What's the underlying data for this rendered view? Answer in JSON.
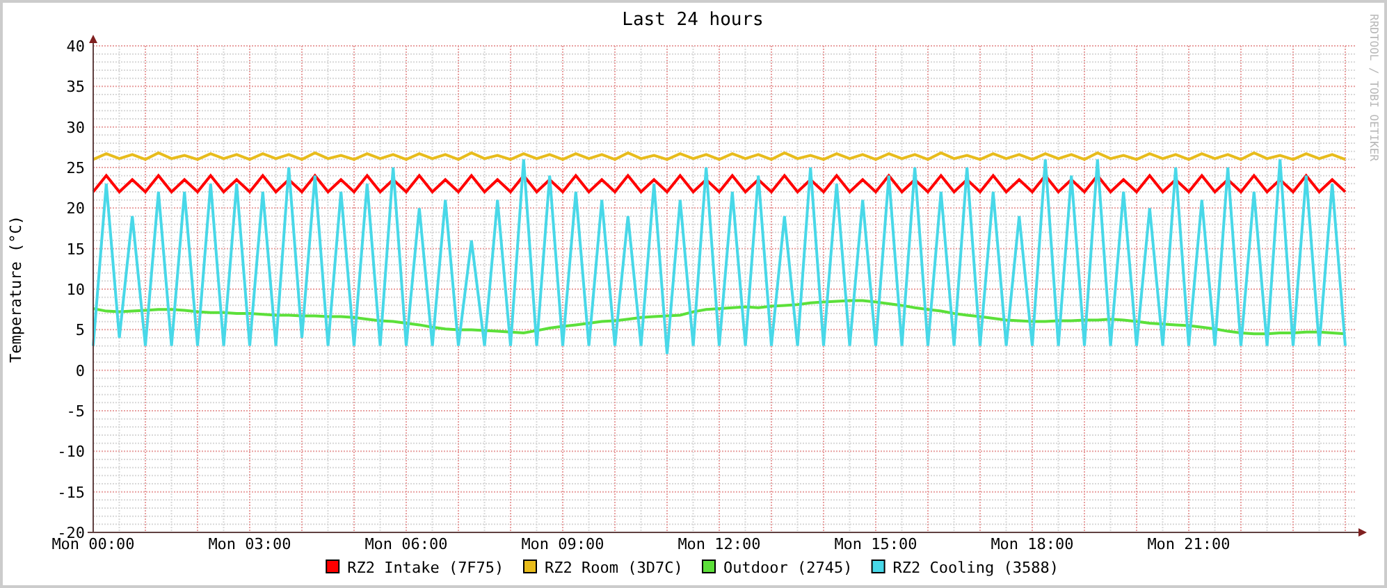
{
  "graph": {
    "credit": "RRDTOOL / TOBI OETIKER",
    "chart_data": {
      "type": "line",
      "title": "Last 24 hours",
      "ylabel": "Temperature (°C)",
      "categories": [
        "Mon 00:00",
        null,
        null,
        null,
        null,
        null,
        null,
        null,
        null,
        null,
        null,
        null,
        "Mon 03:00",
        null,
        null,
        null,
        null,
        null,
        null,
        null,
        null,
        null,
        null,
        null,
        "Mon 06:00",
        null,
        null,
        null,
        null,
        null,
        null,
        null,
        null,
        null,
        null,
        null,
        "Mon 09:00",
        null,
        null,
        null,
        null,
        null,
        null,
        null,
        null,
        null,
        null,
        null,
        "Mon 12:00",
        null,
        null,
        null,
        null,
        null,
        null,
        null,
        null,
        null,
        null,
        null,
        "Mon 15:00",
        null,
        null,
        null,
        null,
        null,
        null,
        null,
        null,
        null,
        null,
        null,
        "Mon 18:00",
        null,
        null,
        null,
        null,
        null,
        null,
        null,
        null,
        null,
        null,
        null,
        "Mon 21:00",
        null,
        null,
        null,
        null,
        null,
        null,
        null,
        null,
        null,
        null,
        null,
        null
      ],
      "ylim": [
        -20,
        40
      ],
      "grid": true,
      "legend": "bottom",
      "yticks": [
        -20,
        -15,
        -10,
        -5,
        0,
        5,
        10,
        15,
        20,
        25,
        30,
        35,
        40
      ],
      "series": [
        {
          "name": "RZ2 Intake (7F75)",
          "color": "#ff0000",
          "values": [
            22,
            24,
            22,
            23.5,
            22,
            24,
            22,
            23.5,
            22,
            24,
            22,
            23.5,
            22,
            24,
            22,
            23.5,
            22,
            24,
            22,
            23.5,
            22,
            24,
            22,
            23.5,
            22,
            24,
            22,
            23.5,
            22,
            24,
            22,
            23.5,
            22,
            24,
            22,
            23.5,
            22,
            24,
            22,
            23.5,
            22,
            24,
            22,
            23.5,
            22,
            24,
            22,
            23.5,
            22,
            24,
            22,
            23.5,
            22,
            24,
            22,
            23.5,
            22,
            24,
            22,
            23.5,
            22,
            24,
            22,
            23.5,
            22,
            24,
            22,
            23.5,
            22,
            24,
            22,
            23.5,
            22,
            24,
            22,
            23.5,
            22,
            24,
            22,
            23.5,
            22,
            24,
            22,
            23.5,
            22,
            24,
            22,
            23.5,
            22,
            24,
            22,
            23.5,
            22,
            24,
            22,
            23.5,
            22
          ]
        },
        {
          "name": "RZ2 Room (3D7C)",
          "color": "#e8bc1c",
          "values": [
            26,
            26.7,
            26.1,
            26.6,
            26,
            26.8,
            26.1,
            26.5,
            26,
            26.7,
            26.1,
            26.6,
            26,
            26.7,
            26.1,
            26.6,
            26,
            26.8,
            26.1,
            26.5,
            26,
            26.7,
            26.1,
            26.6,
            26,
            26.7,
            26.1,
            26.6,
            26,
            26.8,
            26.1,
            26.5,
            26,
            26.7,
            26.1,
            26.6,
            26,
            26.7,
            26.1,
            26.6,
            26,
            26.8,
            26.1,
            26.5,
            26,
            26.7,
            26.1,
            26.6,
            26,
            26.7,
            26.1,
            26.6,
            26,
            26.8,
            26.1,
            26.5,
            26,
            26.7,
            26.1,
            26.6,
            26,
            26.7,
            26.1,
            26.6,
            26,
            26.8,
            26.1,
            26.5,
            26,
            26.7,
            26.1,
            26.6,
            26,
            26.7,
            26.1,
            26.6,
            26,
            26.8,
            26.1,
            26.5,
            26,
            26.7,
            26.1,
            26.6,
            26,
            26.7,
            26.1,
            26.6,
            26,
            26.8,
            26.1,
            26.5,
            26,
            26.7,
            26.1,
            26.6,
            26
          ]
        },
        {
          "name": "Outdoor (2745)",
          "color": "#5ce03a",
          "values": [
            7.6,
            7.3,
            7.2,
            7.3,
            7.4,
            7.5,
            7.5,
            7.4,
            7.2,
            7.1,
            7.1,
            7,
            7,
            6.9,
            6.8,
            6.8,
            6.7,
            6.7,
            6.6,
            6.6,
            6.5,
            6.3,
            6.1,
            6,
            5.8,
            5.6,
            5.3,
            5.1,
            5,
            5,
            4.9,
            4.8,
            4.7,
            4.6,
            4.9,
            5.2,
            5.4,
            5.6,
            5.8,
            6,
            6.1,
            6.3,
            6.5,
            6.6,
            6.7,
            6.8,
            7.2,
            7.5,
            7.6,
            7.7,
            7.8,
            7.7,
            7.9,
            8,
            8.1,
            8.3,
            8.4,
            8.5,
            8.6,
            8.6,
            8.4,
            8.2,
            8,
            7.7,
            7.5,
            7.3,
            7,
            6.8,
            6.6,
            6.4,
            6.2,
            6.1,
            6,
            6,
            6.1,
            6.1,
            6.2,
            6.2,
            6.3,
            6.2,
            6,
            5.8,
            5.7,
            5.6,
            5.5,
            5.3,
            5.1,
            4.8,
            4.6,
            4.5,
            4.5,
            4.6,
            4.6,
            4.7,
            4.7,
            4.6,
            4.5
          ]
        },
        {
          "name": "RZ2 Cooling (3588)",
          "color": "#48d8e8",
          "values": [
            3,
            23,
            4,
            19,
            3,
            22,
            3,
            22,
            3,
            23,
            3,
            23,
            3,
            22,
            3,
            25,
            4,
            24,
            3,
            22,
            3,
            23,
            3,
            25,
            3,
            20,
            3,
            21,
            3,
            16,
            3,
            21,
            3,
            26,
            3,
            24,
            3,
            22,
            3,
            21,
            3,
            19,
            3,
            23,
            2,
            21,
            3,
            25,
            3,
            22,
            3,
            24,
            3,
            19,
            3,
            25,
            3,
            23,
            3,
            21,
            3,
            24,
            3,
            25,
            3,
            22,
            3,
            25,
            3,
            22,
            3,
            19,
            3,
            26,
            3,
            24,
            3,
            26,
            3,
            22,
            3,
            20,
            3,
            25,
            3,
            21,
            3,
            25,
            3,
            22,
            3,
            26,
            3,
            24,
            3,
            23,
            3
          ]
        }
      ]
    }
  }
}
